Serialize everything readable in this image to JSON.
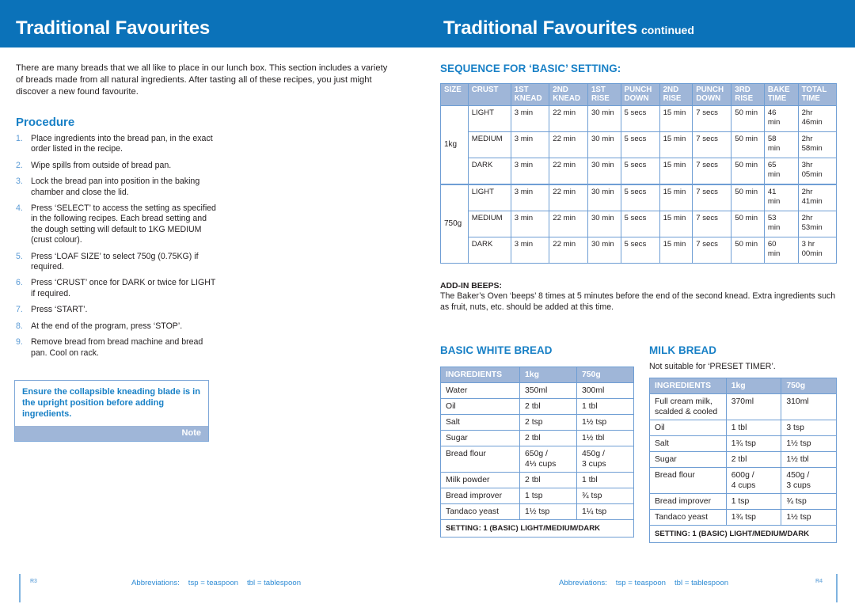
{
  "left_page": {
    "header": {
      "title": "Traditional Favourites"
    },
    "intro": "There are many breads that we all like to place in our lunch box. This section includes a variety of breads made from all natural ingredients. After tasting all of these recipes, you just might discover a new found favourite.",
    "procedure_heading": "Procedure",
    "procedure_steps": [
      "Place ingredients into the bread pan, in the exact order listed in the recipe.",
      "Wipe spills from outside of bread pan.",
      "Lock the bread pan into position in the baking chamber and close the lid.",
      "Press ‘SELECT’ to access the setting as specified in the following recipes. Each bread setting and the dough setting will default to 1KG MEDIUM (crust colour).",
      "Press ‘LOAF SIZE’ to select 750g (0.75KG) if required.",
      "Press ‘CRUST’ once for DARK or twice for LIGHT if required.",
      "Press ‘START’.",
      "At the end of the program, press ‘STOP’.",
      "Remove bread from bread machine and bread pan. Cool on rack."
    ],
    "note": {
      "text": "Ensure the collapsible kneading blade is in the upright position before adding ingredients.",
      "label": "Note"
    },
    "footer": {
      "page_number": "R3",
      "abbrev_label": "Abbreviations:",
      "abbrev_tsp": "tsp = teaspoon",
      "abbrev_tbl": "tbl = tablespoon"
    }
  },
  "right_page": {
    "header": {
      "title": "Traditional Favourites",
      "continued": "continued"
    },
    "sequence": {
      "heading": "SEQUENCE FOR ‘BASIC’ SETTING:",
      "columns": [
        "SIZE",
        "CRUST",
        "1ST KNEAD",
        "2ND KNEAD",
        "1ST RISE",
        "PUNCH DOWN",
        "2ND RISE",
        "PUNCH DOWN",
        "3RD RISE",
        "BAKE TIME",
        "TOTAL TIME"
      ],
      "groups": [
        {
          "size": "1kg",
          "rows": [
            {
              "crust": "LIGHT",
              "knead1": "3 min",
              "knead2": "22 min",
              "rise1": "30 min",
              "punch1": "5 secs",
              "rise2": "15 min",
              "punch2": "7 secs",
              "rise3": "50 min",
              "bake": "46 min",
              "total": "2hr 46min"
            },
            {
              "crust": "MEDIUM",
              "knead1": "3 min",
              "knead2": "22 min",
              "rise1": "30 min",
              "punch1": "5 secs",
              "rise2": "15 min",
              "punch2": "7 secs",
              "rise3": "50 min",
              "bake": "58 min",
              "total": "2hr 58min"
            },
            {
              "crust": "DARK",
              "knead1": "3 min",
              "knead2": "22 min",
              "rise1": "30 min",
              "punch1": "5 secs",
              "rise2": "15 min",
              "punch2": "7 secs",
              "rise3": "50 min",
              "bake": "65 min",
              "total": "3hr 05min"
            }
          ]
        },
        {
          "size": "750g",
          "rows": [
            {
              "crust": "LIGHT",
              "knead1": "3 min",
              "knead2": "22 min",
              "rise1": "30 min",
              "punch1": "5 secs",
              "rise2": "15 min",
              "punch2": "7 secs",
              "rise3": "50 min",
              "bake": "41 min",
              "total": "2hr 41min"
            },
            {
              "crust": "MEDIUM",
              "knead1": "3 min",
              "knead2": "22 min",
              "rise1": "30 min",
              "punch1": "5 secs",
              "rise2": "15 min",
              "punch2": "7 secs",
              "rise3": "50 min",
              "bake": "53 min",
              "total": "2hr 53min"
            },
            {
              "crust": "DARK",
              "knead1": "3 min",
              "knead2": "22 min",
              "rise1": "30 min",
              "punch1": "5 secs",
              "rise2": "15 min",
              "punch2": "7 secs",
              "rise3": "50 min",
              "bake": "60 min",
              "total": "3 hr 00min"
            }
          ]
        }
      ]
    },
    "add_in_beeps": {
      "heading": "ADD-IN BEEPS:",
      "body": "The Baker’s Oven ‘beeps’ 8 times at 5 minutes before the end of the second knead. Extra ingredients such as fruit, nuts, etc. should be added at this time."
    },
    "recipes": [
      {
        "title": "BASIC WHITE BREAD",
        "subnote": "",
        "columns": [
          "INGREDIENTS",
          "1kg",
          "750g"
        ],
        "rows": [
          {
            "ingredient": "Water",
            "kg1": "350ml",
            "g750": "300ml"
          },
          {
            "ingredient": "Oil",
            "kg1": "2 tbl",
            "g750": "1 tbl"
          },
          {
            "ingredient": "Salt",
            "kg1": "2 tsp",
            "g750": "1½ tsp"
          },
          {
            "ingredient": "Sugar",
            "kg1": "2 tbl",
            "g750": "1½ tbl"
          },
          {
            "ingredient": "Bread flour",
            "kg1": "650g /\n4⅓ cups",
            "g750": "450g /\n3 cups"
          },
          {
            "ingredient": "Milk powder",
            "kg1": "2 tbl",
            "g750": "1 tbl"
          },
          {
            "ingredient": "Bread improver",
            "kg1": "1 tsp",
            "g750": "¾ tsp"
          },
          {
            "ingredient": "Tandaco yeast",
            "kg1": "1½ tsp",
            "g750": "1¼ tsp"
          }
        ],
        "setting": "SETTING: 1 (BASIC) LIGHT/MEDIUM/DARK"
      },
      {
        "title": "MILK BREAD",
        "subnote": "Not suitable for ‘PRESET TIMER’.",
        "columns": [
          "INGREDIENTS",
          "1kg",
          "750g"
        ],
        "rows": [
          {
            "ingredient": "Full cream milk, scalded & cooled",
            "kg1": "370ml",
            "g750": "310ml"
          },
          {
            "ingredient": "Oil",
            "kg1": "1 tbl",
            "g750": "3 tsp"
          },
          {
            "ingredient": "Salt",
            "kg1": "1¾ tsp",
            "g750": "1½ tsp"
          },
          {
            "ingredient": "Sugar",
            "kg1": "2 tbl",
            "g750": "1½ tbl"
          },
          {
            "ingredient": "Bread flour",
            "kg1": "600g /\n4 cups",
            "g750": "450g /\n3 cups"
          },
          {
            "ingredient": "Bread improver",
            "kg1": "1 tsp",
            "g750": "¾ tsp"
          },
          {
            "ingredient": "Tandaco yeast",
            "kg1": "1¾ tsp",
            "g750": "1½ tsp"
          }
        ],
        "setting": "SETTING: 1 (BASIC) LIGHT/MEDIUM/DARK"
      }
    ],
    "footer": {
      "page_number": "R4",
      "abbrev_label": "Abbreviations:",
      "abbrev_tsp": "tsp = teaspoon",
      "abbrev_tbl": "tbl = tablespoon"
    }
  },
  "theme": {
    "header_blue": "#0b72b9",
    "accent_blue": "#1880c6",
    "table_header_blue": "#9fb6d8",
    "table_border": "#6f9ed4",
    "footer_blue": "#2e8bd4"
  }
}
